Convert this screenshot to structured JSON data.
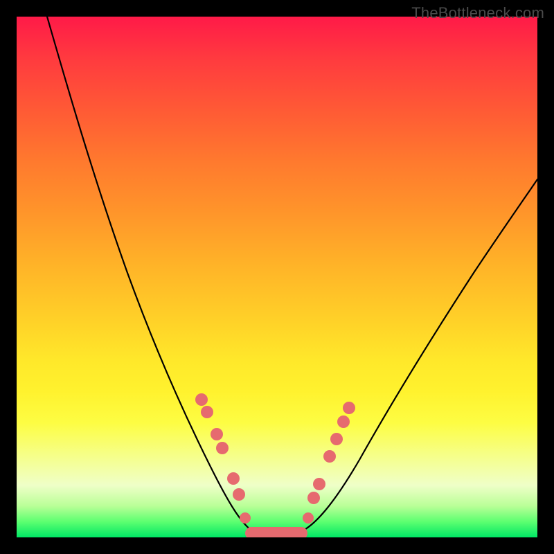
{
  "watermark": "TheBottleneck.com",
  "colors": {
    "dot": "#e66a6f",
    "line": "#000000",
    "frame": "#000000"
  },
  "chart_data": {
    "type": "line",
    "title": "",
    "xlabel": "",
    "ylabel": "",
    "xlim": [
      0,
      100
    ],
    "ylim": [
      0,
      100
    ],
    "grid": false,
    "legend": false,
    "series": [
      {
        "name": "bottleneck-curve",
        "x": [
          6,
          10,
          14,
          18,
          22,
          26,
          30,
          34,
          38,
          40,
          42,
          43,
          44,
          45,
          46,
          47,
          48,
          49,
          50,
          51,
          52,
          53,
          55,
          57,
          60,
          64,
          68,
          72,
          76,
          80,
          84,
          88,
          92,
          96,
          100
        ],
        "y": [
          100,
          93,
          86,
          78,
          70,
          62,
          53,
          44,
          34,
          28,
          22,
          18,
          14,
          10,
          6,
          3,
          1.5,
          1,
          1,
          1,
          1,
          1.5,
          3,
          6,
          11,
          18,
          25,
          32,
          39,
          45,
          50,
          55,
          59,
          63,
          66
        ]
      }
    ],
    "trough_markers": {
      "left_branch_points_y": [
        27,
        24.5,
        20,
        17,
        11,
        8
      ],
      "right_branch_points_y": [
        25,
        22,
        18.5,
        15,
        9.5,
        7
      ],
      "bottom_flat_fraction": [
        0.43,
        0.56
      ]
    },
    "background_gradient": {
      "top": "#ff1a48",
      "mid": "#ffe82a",
      "bottom": "#00e765"
    }
  }
}
